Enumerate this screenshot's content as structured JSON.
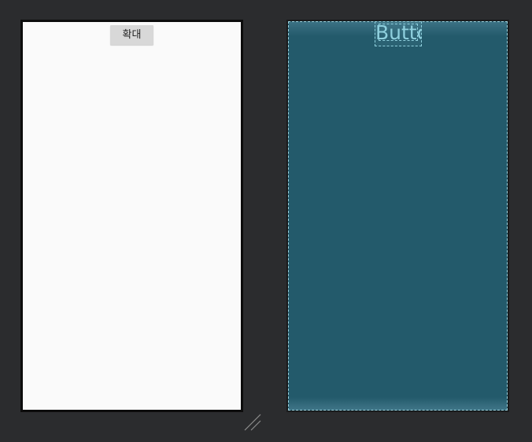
{
  "design_preview": {
    "button_label": "확대"
  },
  "blueprint_preview": {
    "button_label": "Butto"
  },
  "icons": {
    "resize": "resize-handle-icon"
  },
  "colors": {
    "workspace_background": "#2b2c2e",
    "design_screen": "#fafafa",
    "design_button": "#d8d8d8",
    "blueprint_screen": "#235a6b",
    "blueprint_outline": "#8fd0de"
  }
}
